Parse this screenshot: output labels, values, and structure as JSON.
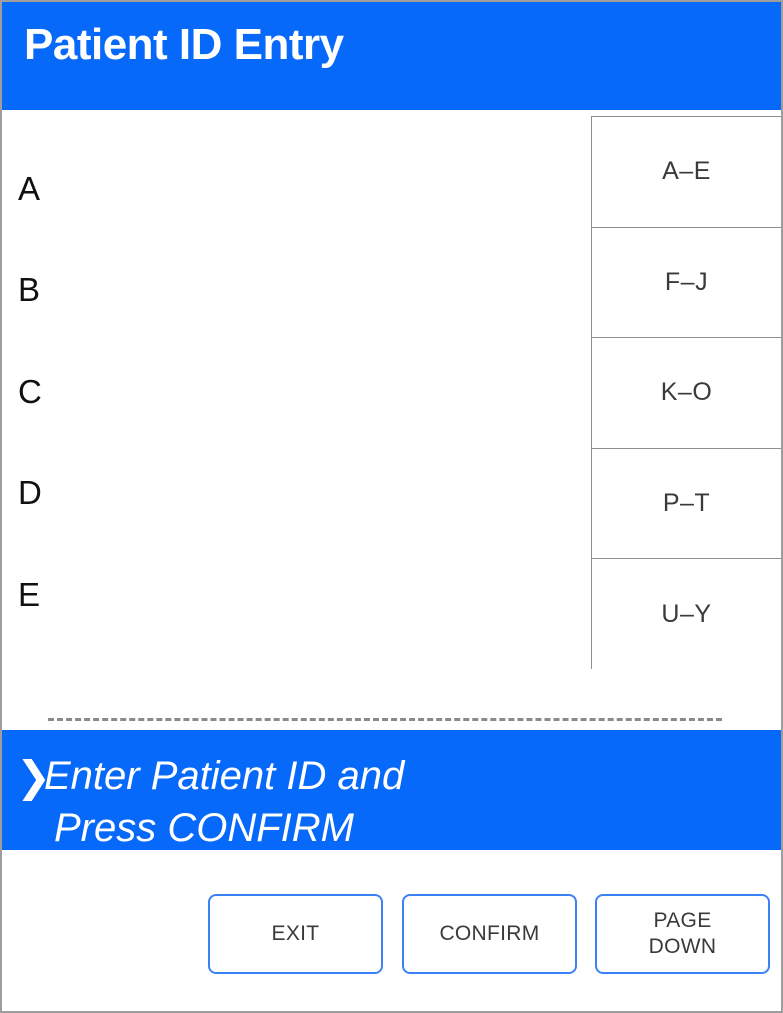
{
  "window": {
    "title": "Patient ID Entry",
    "accent_blue": "#0669FA",
    "button_border_blue": "#3B82F6",
    "frame_gray": "#9E9E9E",
    "text_gray": "#3A3A3A"
  },
  "entry_list": {
    "rows": [
      {
        "label": "A"
      },
      {
        "label": "B"
      },
      {
        "label": "C"
      },
      {
        "label": "D"
      },
      {
        "label": "E"
      }
    ]
  },
  "input_field": {
    "value": "",
    "style": "dashed-underline"
  },
  "range_buttons": [
    {
      "label": "A–E"
    },
    {
      "label": "F–J"
    },
    {
      "label": "K–O"
    },
    {
      "label": "P–T"
    },
    {
      "label": "U–Y"
    }
  ],
  "message": {
    "chevron": "❯",
    "line1": "Enter Patient ID and",
    "line2": "Press CONFIRM"
  },
  "actions": [
    {
      "label": "EXIT"
    },
    {
      "label": "CONFIRM"
    },
    {
      "label_line1": "PAGE",
      "label_line2": "DOWN"
    }
  ]
}
